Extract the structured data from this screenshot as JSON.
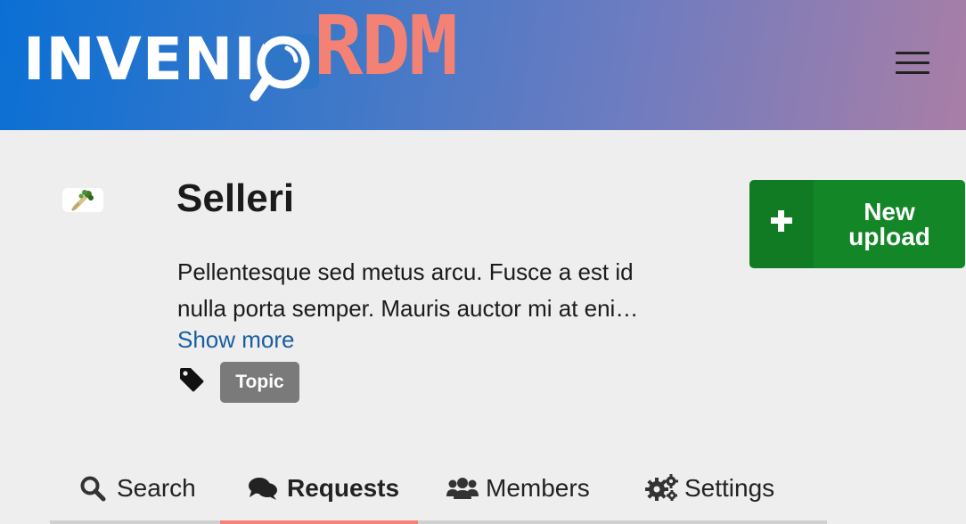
{
  "header": {
    "logo_text_primary": "INVENIO",
    "logo_text_accent": "RDM",
    "menu_icon": "hamburger-menu-icon"
  },
  "community": {
    "avatar_icon": "celery-icon",
    "title": "Selleri",
    "description": "Pellentesque sed metus arcu. Fusce a est id nulla porta semper. Mauris auctor mi at eni…",
    "show_more_label": "Show more",
    "tag_icon": "tag-icon",
    "topic_label": "Topic"
  },
  "actions": {
    "new_upload_icon": "plus-icon",
    "new_upload_label": "New upload",
    "color": "#138627"
  },
  "tabs": [
    {
      "label": "Search",
      "icon": "search-icon",
      "active": false
    },
    {
      "label": "Requests",
      "icon": "comments-icon",
      "active": true
    },
    {
      "label": "Members",
      "icon": "users-icon",
      "active": false
    },
    {
      "label": "Settings",
      "icon": "gears-icon",
      "active": false
    }
  ],
  "colors": {
    "accent": "#f48274",
    "link": "#1a5da0",
    "badge": "#7a7a7a"
  }
}
